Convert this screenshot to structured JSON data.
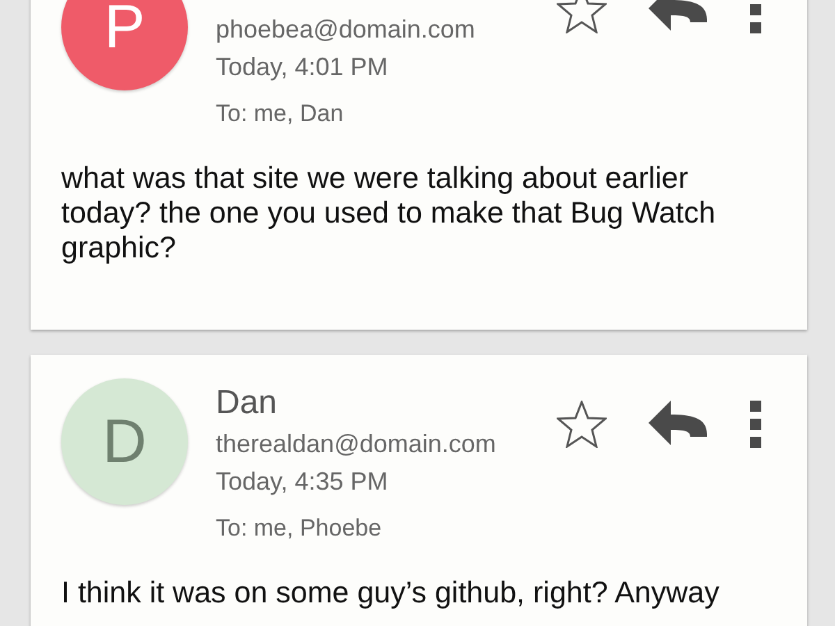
{
  "messages": [
    {
      "avatar": {
        "letter": "P",
        "color": "#ef5b69"
      },
      "email": "phoebea@domain.com",
      "time": "Today, 4:01 PM",
      "recipients": "To: me, Dan",
      "starred": false,
      "body": "what was that site we were talking about earlier today? the one you used to make that Bug Watch graphic?"
    },
    {
      "avatar": {
        "letter": "D",
        "color": "#d5e8d4"
      },
      "name": "Dan",
      "email": "therealdan@domain.com",
      "time": "Today, 4:35 PM",
      "recipients": "To: me, Phoebe",
      "starred": false,
      "body": "I think it was on some guy’s github, right? Anyway"
    }
  ]
}
